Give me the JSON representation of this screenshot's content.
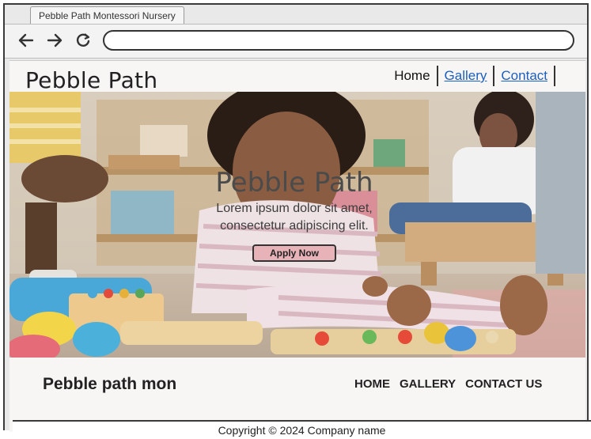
{
  "browser": {
    "tab_title": "Pebble Path Montessori Nursery",
    "address_value": ""
  },
  "header": {
    "logo": "Pebble Path",
    "nav": [
      {
        "label": "Home"
      },
      {
        "label": "Gallery"
      },
      {
        "label": "Contact"
      }
    ]
  },
  "hero": {
    "title": "Pebble Path",
    "description": "Lorem ipsum dolor sit amet, consectetur adipiscing elit.",
    "button": "Apply Now"
  },
  "footer": {
    "title": "Pebble path mon",
    "nav": [
      "HOME",
      "GALLERY",
      "CONTACT US"
    ],
    "copyright": "Copyright © 2024 Company name"
  },
  "icons": {
    "back": "back-arrow-icon",
    "forward": "forward-arrow-icon",
    "reload": "reload-icon"
  },
  "colors": {
    "link": "#1d5fbf",
    "button": "#e8b3b8",
    "page_bg": "#f7f6f4"
  }
}
